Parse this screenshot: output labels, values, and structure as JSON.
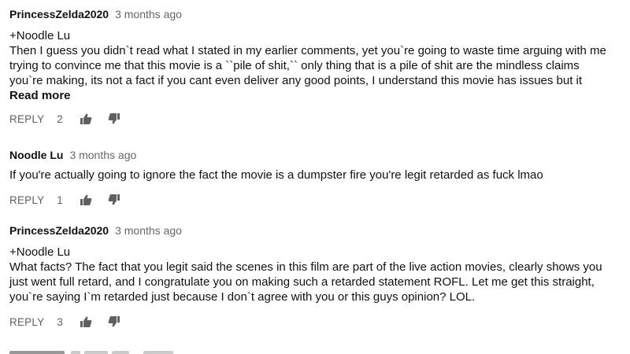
{
  "colors": {
    "text": "#111111",
    "meta": "#666666",
    "action": "#606060"
  },
  "comments": [
    {
      "author": "PrincessZelda2020",
      "time": "3 months ago",
      "lines": [
        "+Noodle Lu",
        "Then I guess you didn`t read what I stated in my earlier comments, yet you`re going to waste time arguing with me",
        "trying to convince me that this movie is a ``pile of shit,`` only thing that is a pile of shit are the mindless claims",
        "you`re making, its not a fact if you cant even deliver any good points, I understand this movie has issues but it"
      ],
      "read_more": "Read more",
      "reply_label": "REPLY",
      "likes": "2",
      "like_icon": "thumbs-up-icon",
      "dislike_icon": "thumbs-down-icon"
    },
    {
      "author": "Noodle Lu",
      "time": "3 months ago",
      "lines": [
        "If you're actually going to ignore the fact the movie is a dumpster fire you're legit retarded as fuck lmao"
      ],
      "reply_label": "REPLY",
      "likes": "1",
      "like_icon": "thumbs-up-icon",
      "dislike_icon": "thumbs-down-icon"
    },
    {
      "author": "PrincessZelda2020",
      "time": "3 months ago",
      "lines": [
        "+Noodle Lu",
        "What facts? The fact that you legit said the scenes in this film are part of the live action movies, clearly shows you",
        "just went full retard, and I congratulate you on making such a retarded statement ROFL. Let me get this straight,",
        "you`re saying I`m retarded just because I don`t agree with you or this guys opinion? LOL."
      ],
      "reply_label": "REPLY",
      "likes": "3",
      "like_icon": "thumbs-up-icon",
      "dislike_icon": "thumbs-down-icon"
    }
  ]
}
